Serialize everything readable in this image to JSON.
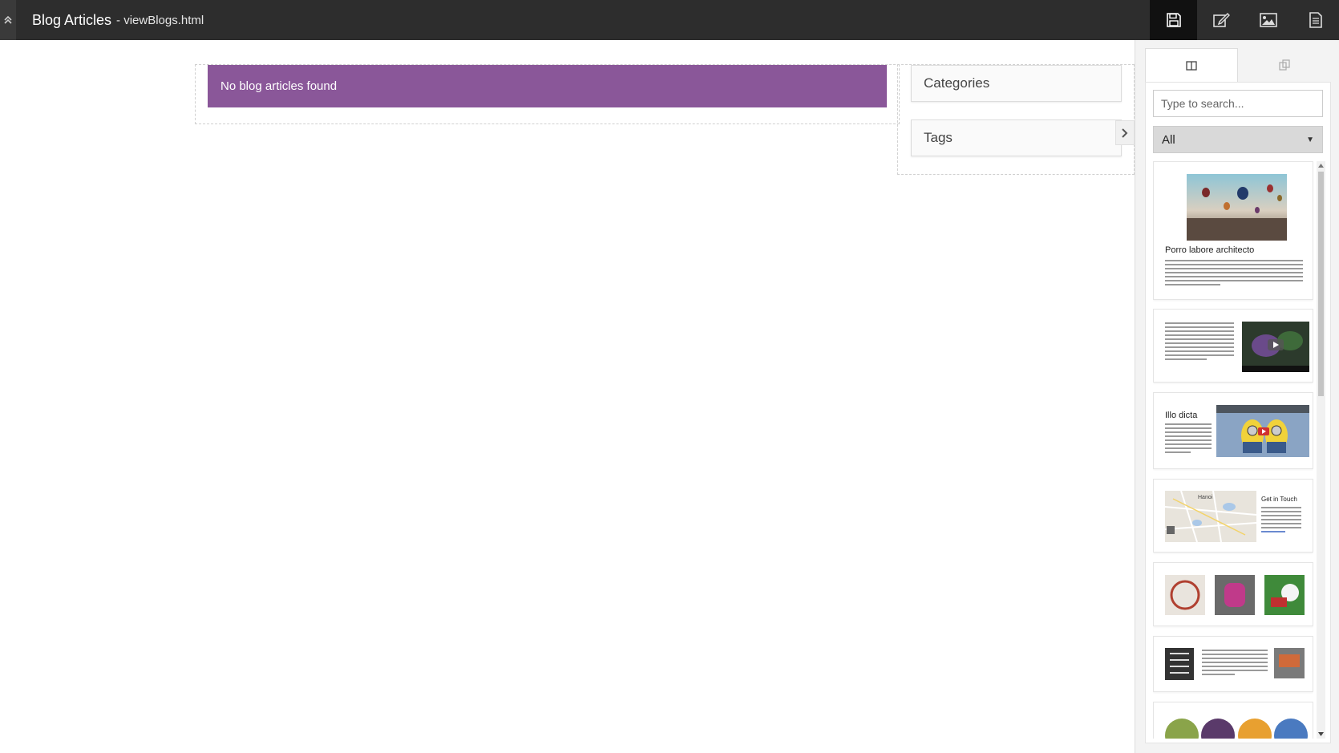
{
  "header": {
    "title": "Blog Articles",
    "subtitle": "- viewBlogs.html",
    "toolbar": [
      {
        "icon": "save-icon",
        "active": true
      },
      {
        "icon": "edit-icon",
        "active": false
      },
      {
        "icon": "image-icon",
        "active": false
      },
      {
        "icon": "page-icon",
        "active": false
      }
    ]
  },
  "main": {
    "alert_text": "No blog articles found"
  },
  "sidebar": {
    "categories_label": "Categories",
    "tags_label": "Tags"
  },
  "panel": {
    "tabs": [
      "blocks-tab",
      "components-tab"
    ],
    "search_placeholder": "Type to search...",
    "filter_value": "All",
    "snippets": [
      {
        "title": "Porro labore architecto"
      },
      {
        "title": ""
      },
      {
        "title": "Illo dicta"
      },
      {
        "title": "Get in Touch",
        "map_label": "Hanoi"
      },
      {
        "title": ""
      },
      {
        "title": ""
      },
      {
        "title": ""
      }
    ]
  },
  "colors": {
    "topbar": "#2d2d2d",
    "alert": "#8a5799"
  }
}
